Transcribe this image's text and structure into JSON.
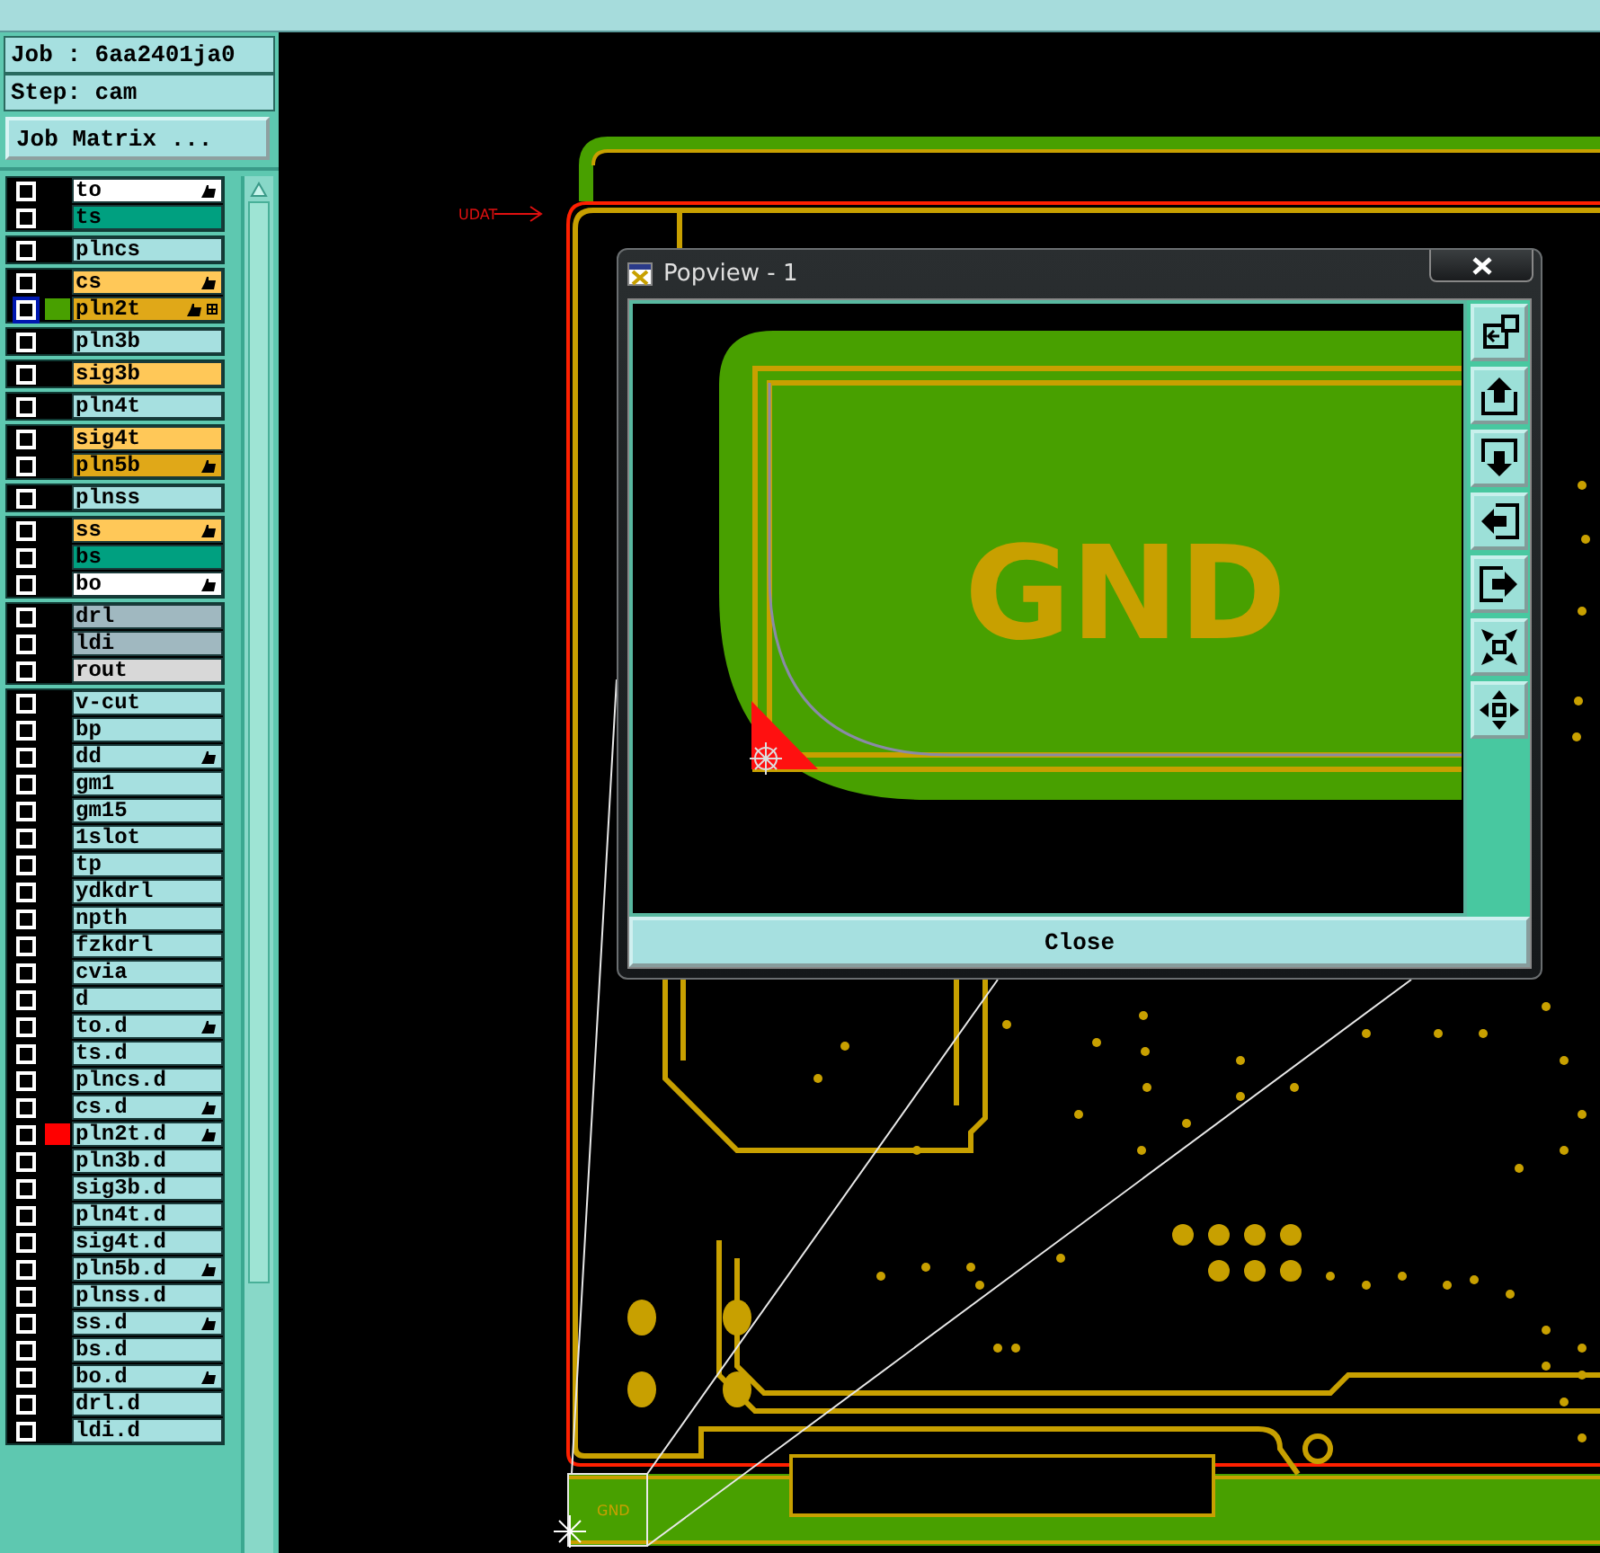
{
  "job_line": "Job : 6aa2401ja0",
  "step_line": "Step: cam",
  "job_matrix_button": "Job Matrix ...",
  "layer_groups": [
    {
      "layers": [
        {
          "name": "to",
          "color": "#ffffff",
          "affected": true,
          "selected": false,
          "work_layer": false
        },
        {
          "name": "ts",
          "color": "#00a080",
          "affected": false,
          "selected": false,
          "work_layer": false
        }
      ]
    },
    {
      "layers": [
        {
          "name": "plncs",
          "color": "#a6e0e0",
          "affected": false,
          "selected": false,
          "work_layer": false
        }
      ]
    },
    {
      "layers": [
        {
          "name": "cs",
          "color": "#ffc858",
          "affected": true,
          "selected": false,
          "work_layer": false
        },
        {
          "name": "pln2t",
          "color": "#e0a818",
          "affected": true,
          "selected": true,
          "work_layer": true,
          "swatch": {
            "color": "#48a000"
          }
        }
      ]
    },
    {
      "layers": [
        {
          "name": "pln3b",
          "color": "#a6e0e0",
          "affected": false,
          "selected": false,
          "work_layer": false
        }
      ]
    },
    {
      "layers": [
        {
          "name": "sig3b",
          "color": "#ffc858",
          "affected": false,
          "selected": false,
          "work_layer": false
        }
      ]
    },
    {
      "layers": [
        {
          "name": "pln4t",
          "color": "#a6e0e0",
          "affected": false,
          "selected": false,
          "work_layer": false
        }
      ]
    },
    {
      "layers": [
        {
          "name": "sig4t",
          "color": "#ffc858",
          "affected": false,
          "selected": false,
          "work_layer": false
        },
        {
          "name": "pln5b",
          "color": "#e0a818",
          "affected": true,
          "selected": false,
          "work_layer": false
        }
      ]
    },
    {
      "layers": [
        {
          "name": "plnss",
          "color": "#a6e0e0",
          "affected": false,
          "selected": false,
          "work_layer": false
        }
      ]
    },
    {
      "layers": [
        {
          "name": "ss",
          "color": "#ffc858",
          "affected": true,
          "selected": false,
          "work_layer": false
        },
        {
          "name": "bs",
          "color": "#00a080",
          "affected": false,
          "selected": false,
          "work_layer": false
        },
        {
          "name": "bo",
          "color": "#ffffff",
          "affected": true,
          "selected": false,
          "work_layer": false
        }
      ]
    },
    {
      "layers": [
        {
          "name": "drl",
          "color": "#a0b8c0",
          "affected": false,
          "selected": false,
          "work_layer": false
        },
        {
          "name": "ldi",
          "color": "#a0b8c0",
          "affected": false,
          "selected": false,
          "work_layer": false
        },
        {
          "name": "rout",
          "color": "#d8d8d8",
          "affected": false,
          "selected": false,
          "work_layer": false
        }
      ]
    },
    {
      "layers": [
        {
          "name": "v-cut",
          "color": "#a6e0e0",
          "affected": false,
          "selected": false,
          "work_layer": false
        },
        {
          "name": "bp",
          "color": "#a6e0e0",
          "affected": false,
          "selected": false,
          "work_layer": false
        },
        {
          "name": "dd",
          "color": "#a6e0e0",
          "affected": true,
          "selected": false,
          "work_layer": false
        },
        {
          "name": "gm1",
          "color": "#a6e0e0",
          "affected": false,
          "selected": false,
          "work_layer": false
        },
        {
          "name": "gm15",
          "color": "#a6e0e0",
          "affected": false,
          "selected": false,
          "work_layer": false
        },
        {
          "name": "1slot",
          "color": "#a6e0e0",
          "affected": false,
          "selected": false,
          "work_layer": false
        },
        {
          "name": "tp",
          "color": "#a6e0e0",
          "affected": false,
          "selected": false,
          "work_layer": false
        },
        {
          "name": "ydkdrl",
          "color": "#a6e0e0",
          "affected": false,
          "selected": false,
          "work_layer": false
        },
        {
          "name": "npth",
          "color": "#a6e0e0",
          "affected": false,
          "selected": false,
          "work_layer": false
        },
        {
          "name": "fzkdrl",
          "color": "#a6e0e0",
          "affected": false,
          "selected": false,
          "work_layer": false
        },
        {
          "name": "cvia",
          "color": "#a6e0e0",
          "affected": false,
          "selected": false,
          "work_layer": false
        },
        {
          "name": "d",
          "color": "#a6e0e0",
          "affected": false,
          "selected": false,
          "work_layer": false
        },
        {
          "name": "to.d",
          "color": "#a6e0e0",
          "affected": true,
          "selected": false,
          "work_layer": false
        },
        {
          "name": "ts.d",
          "color": "#a6e0e0",
          "affected": false,
          "selected": false,
          "work_layer": false
        },
        {
          "name": "plncs.d",
          "color": "#a6e0e0",
          "affected": false,
          "selected": false,
          "work_layer": false
        },
        {
          "name": "cs.d",
          "color": "#a6e0e0",
          "affected": true,
          "selected": false,
          "work_layer": false
        },
        {
          "name": "pln2t.d",
          "color": "#a6e0e0",
          "affected": true,
          "selected": false,
          "work_layer": false,
          "swatch": {
            "color": "#ff0000"
          }
        },
        {
          "name": "pln3b.d",
          "color": "#a6e0e0",
          "affected": false,
          "selected": false,
          "work_layer": false
        },
        {
          "name": "sig3b.d",
          "color": "#a6e0e0",
          "affected": false,
          "selected": false,
          "work_layer": false
        },
        {
          "name": "pln4t.d",
          "color": "#a6e0e0",
          "affected": false,
          "selected": false,
          "work_layer": false
        },
        {
          "name": "sig4t.d",
          "color": "#a6e0e0",
          "affected": false,
          "selected": false,
          "work_layer": false
        },
        {
          "name": "pln5b.d",
          "color": "#a6e0e0",
          "affected": true,
          "selected": false,
          "work_layer": false
        },
        {
          "name": "plnss.d",
          "color": "#a6e0e0",
          "affected": false,
          "selected": false,
          "work_layer": false
        },
        {
          "name": "ss.d",
          "color": "#a6e0e0",
          "affected": true,
          "selected": false,
          "work_layer": false
        },
        {
          "name": "bs.d",
          "color": "#a6e0e0",
          "affected": false,
          "selected": false,
          "work_layer": false
        },
        {
          "name": "bo.d",
          "color": "#a6e0e0",
          "affected": true,
          "selected": false,
          "work_layer": false
        },
        {
          "name": "drl.d",
          "color": "#a6e0e0",
          "affected": false,
          "selected": false,
          "work_layer": false
        },
        {
          "name": "ldi.d",
          "color": "#a6e0e0",
          "affected": false,
          "selected": false,
          "work_layer": false
        }
      ]
    }
  ],
  "canvas": {
    "arrow_label": "UDAT",
    "board_label": "GND"
  },
  "popview": {
    "title": "Popview - 1",
    "view_label": "GND",
    "close_button": "Close"
  }
}
